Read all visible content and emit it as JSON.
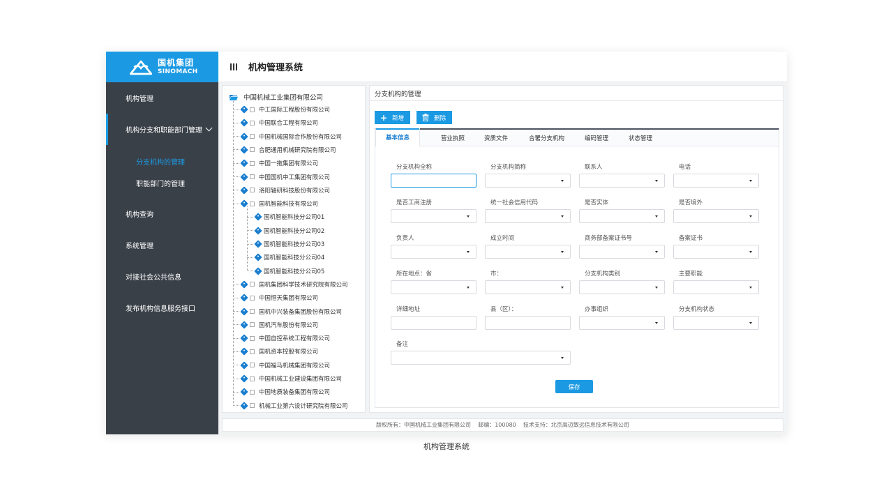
{
  "logo": {
    "cn": "国机集团",
    "en": "SINOMACH"
  },
  "header": {
    "title": "机构管理系统"
  },
  "sidebar": {
    "items": [
      {
        "label": "机构管理"
      },
      {
        "label": "机构分支和职能部门管理"
      },
      {
        "label": "机构查询"
      },
      {
        "label": "系统管理"
      },
      {
        "label": "对接社会公共信息"
      },
      {
        "label": "发布机构信息服务接口"
      }
    ],
    "subitems": [
      {
        "label": "分支机构的管理"
      },
      {
        "label": "职能部门的管理"
      }
    ]
  },
  "tree": {
    "root": "中国机械工业集团有限公司",
    "nodes": [
      "中工国际工程股份有限公司",
      "中国联合工程有限公司",
      "中国机械国际合作股份有限公司",
      "合肥通用机械研究院有限公司",
      "中国一拖集团有限公司",
      "中国国机中工集团有限公司",
      "洛阳轴研科技股份有限公司",
      "国机智能科技有限公司",
      "国机智能科技分公司01",
      "国机智能科技分公司02",
      "国机智能科技分公司03",
      "国机智能科技分公司04",
      "国机智能科技分公司05",
      "国机集团科学技术研究院有限公司",
      "中国恒天集团有限公司",
      "国机中兴装备集团股份有限公司",
      "国机汽车股份有限公司",
      "中国自控系统工程有限公司",
      "国机资本控股有限公司",
      "中国福马机械集团有限公司",
      "中国机械工业建设集团有限公司",
      "中国地质装备集团有限公司",
      "机械工业第六设计研究院有限公司"
    ]
  },
  "content": {
    "title": "分支机构的管理",
    "buttons": {
      "add": "新增",
      "delete": "删除"
    },
    "tabs": [
      "基本信息",
      "营业执照",
      "资质文件",
      "合署分支机构",
      "编码管理",
      "状态管理"
    ],
    "fields": [
      "分支机构全称",
      "分支机构简称",
      "联系人",
      "电话",
      "是否工商注册",
      "统一社会信用代码",
      "是否实体",
      "是否境外",
      "负责人",
      "成立时间",
      "商务部备案证书号",
      "备案证书",
      "所在地点：省",
      "市：",
      "分支机构类别",
      "主要职能",
      "详细地址",
      "县（区）：",
      "办事组织",
      "分支机构状态",
      "备注"
    ],
    "save": "保存"
  },
  "footer": "版权所有：中国机械工业集团有限公司    邮编：100080    技术支持：北京高迈致远信息技术有限公司",
  "caption": "机构管理系统",
  "colors": {
    "brand": "#1b9ae3",
    "sidebar": "#3a4048"
  }
}
